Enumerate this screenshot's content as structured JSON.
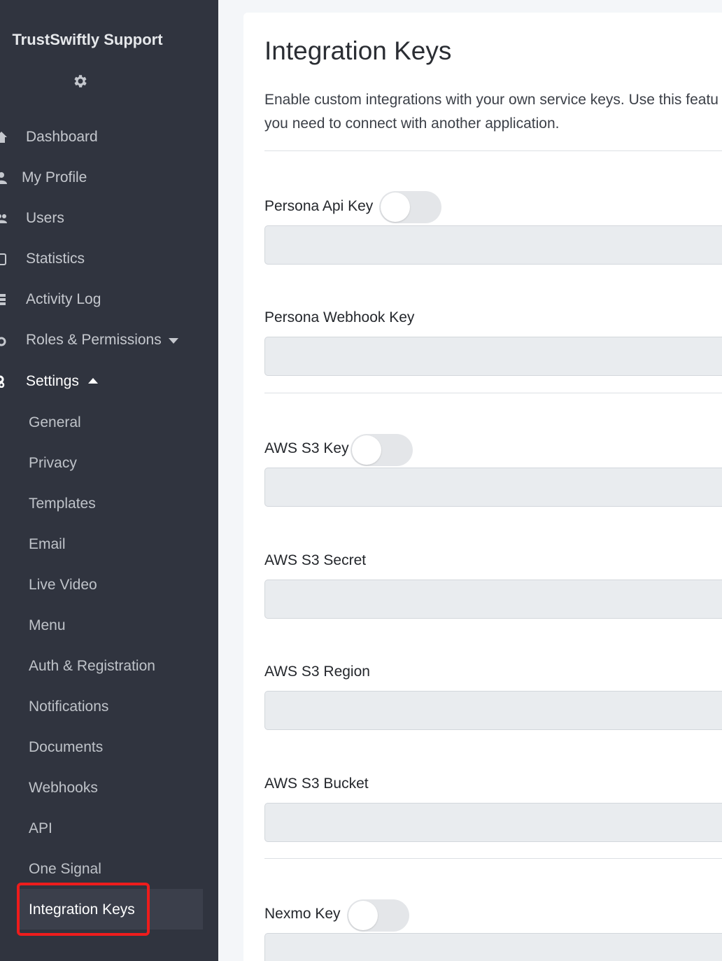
{
  "sidebar": {
    "brand": "TrustSwiftly Support",
    "nav": [
      {
        "label": "Dashboard",
        "icon": "home-icon"
      },
      {
        "label": "My Profile",
        "icon": "user-icon"
      },
      {
        "label": "Users",
        "icon": "users-icon"
      },
      {
        "label": "Statistics",
        "icon": "chart-icon"
      },
      {
        "label": "Activity Log",
        "icon": "server-icon"
      },
      {
        "label": "Roles & Permissions",
        "icon": "gear-icon"
      },
      {
        "label": "Settings",
        "icon": "gears-icon"
      }
    ],
    "settings_sub": [
      "General",
      "Privacy",
      "Templates",
      "Email",
      "Live Video",
      "Menu",
      "Auth & Registration",
      "Notifications",
      "Documents",
      "Webhooks",
      "API",
      "One Signal",
      "Integration Keys"
    ],
    "active_item": "Integration Keys"
  },
  "main": {
    "title": "Integration Keys",
    "description": "Enable custom integrations with your own service keys. Use this featu you need to connect with another application.",
    "description_lines": [
      "Enable custom integrations with your own service keys. Use this featu",
      "you need to connect with another application."
    ],
    "fields": {
      "persona_api_key": {
        "label": "Persona Api Key",
        "toggle": false,
        "value": ""
      },
      "persona_webhook_key": {
        "label": "Persona Webhook Key",
        "value": ""
      },
      "aws_s3_key": {
        "label": "AWS S3 Key",
        "toggle": false,
        "value": ""
      },
      "aws_s3_secret": {
        "label": "AWS S3 Secret",
        "value": ""
      },
      "aws_s3_region": {
        "label": "AWS S3 Region",
        "value": ""
      },
      "aws_s3_bucket": {
        "label": "AWS S3 Bucket",
        "value": ""
      },
      "nexmo_key": {
        "label": "Nexmo Key",
        "toggle": false,
        "value": ""
      }
    }
  },
  "colors": {
    "sidebar_bg": "#30343f",
    "page_bg": "#f4f6f9",
    "highlight": "#ee1c1c",
    "input_bg": "#e9ecef"
  }
}
